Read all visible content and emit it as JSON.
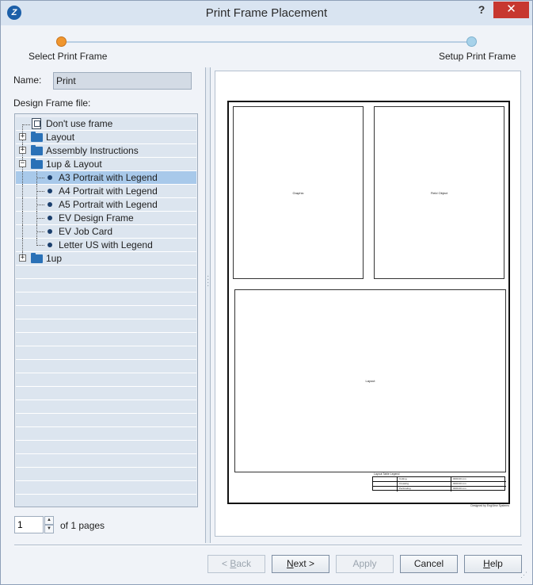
{
  "window": {
    "title": "Print Frame Placement",
    "help_label": "?",
    "close_label": "✕",
    "app_icon_label": "Z"
  },
  "wizard": {
    "step1": "Select Print Frame",
    "step2": "Setup Print Frame",
    "current_step_color": "#f0962f",
    "next_step_color": "#a7d2ea"
  },
  "form": {
    "name_label": "Name:",
    "name_value": "Print",
    "frame_label": "Design Frame file:"
  },
  "tree": {
    "items": [
      {
        "label": "Don't use frame",
        "icon": "frame-icon"
      },
      {
        "label": "Layout",
        "icon": "folder-icon",
        "expander": "+"
      },
      {
        "label": "Assembly Instructions",
        "icon": "folder-icon",
        "expander": "+"
      },
      {
        "label": "1up & Layout",
        "icon": "folder-icon",
        "expander": "−"
      },
      {
        "label": "A3 Portrait with Legend",
        "icon": "bullet-icon",
        "selected": true
      },
      {
        "label": "A4 Portrait with Legend",
        "icon": "bullet-icon"
      },
      {
        "label": "A5 Portrait with Legend",
        "icon": "bullet-icon"
      },
      {
        "label": "EV Design Frame",
        "icon": "bullet-icon"
      },
      {
        "label": "EV Job Card",
        "icon": "bullet-icon"
      },
      {
        "label": "Letter US with Legend",
        "icon": "bullet-icon"
      },
      {
        "label": "1up",
        "icon": "folder-icon",
        "expander": "+"
      }
    ]
  },
  "pager": {
    "page_value": "1",
    "up_arrow": "▲",
    "down_arrow": "▼",
    "of_label": "of 1 pages"
  },
  "preview": {
    "panel1_label": "Graphic",
    "panel2_label": "Field Object",
    "panel3_label": "Layout",
    "legend_title": "Layout Table Legend",
    "legend_rows": [
      {
        "name": "Cutting",
        "value": "0000.00 mm"
      },
      {
        "name": "Creasing",
        "value": "0000.00 mm"
      },
      {
        "name": "Perforating",
        "value": "0000.00 mm"
      }
    ],
    "credit": "Designed by EngView Systems"
  },
  "buttons": {
    "back_prefix": "",
    "back_key": "B",
    "back_rest": "ack",
    "back_arrow": "< ",
    "next_key": "N",
    "next_rest": "ext >",
    "apply": "Apply",
    "cancel": "Cancel",
    "help_key": "H",
    "help_rest": "elp"
  }
}
